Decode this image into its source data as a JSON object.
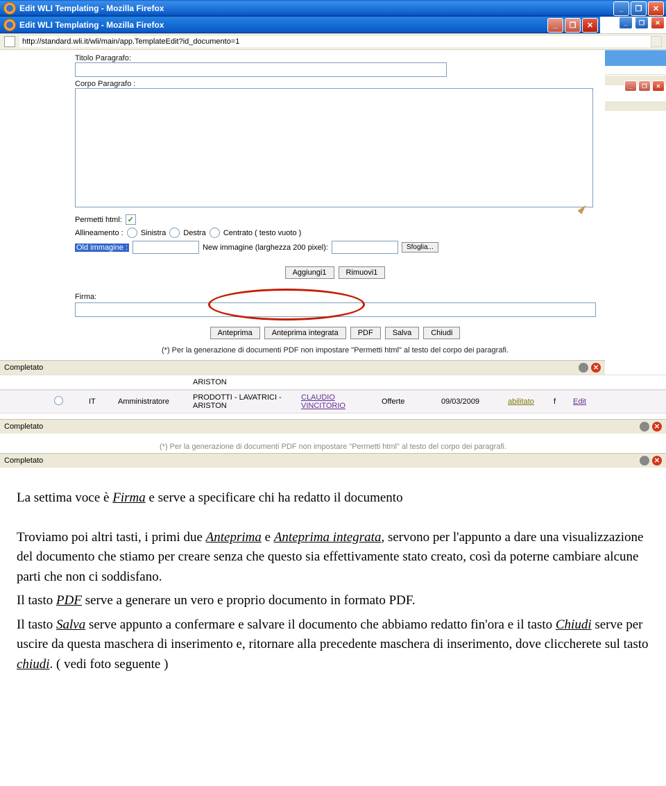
{
  "outer_window": {
    "title": "Edit WLI Templating - Mozilla Firefox"
  },
  "inner_window": {
    "title": "Edit WLI Templating - Mozilla Firefox",
    "url": "http://standard.wli.it/wli/main/app.TemplateEdit?id_documento=1"
  },
  "form": {
    "titolo_label": "Titolo Paragrafo:",
    "corpo_label": "Corpo Paragrafo :",
    "permetti_html_label": "Permetti html:",
    "allineamento_label": "Allineamento :",
    "align_sinistra": "Sinistra",
    "align_destra": "Destra",
    "align_centrato": "Centrato ( testo vuoto )",
    "old_img_label": "Old immagine :",
    "new_img_label": "New immagine (larghezza 200 pixel):",
    "sfoglia_btn": "Sfoglia...",
    "aggiungi_btn": "Aggiungi1",
    "rimuovi_btn": "Rimuovi1",
    "firma_label": "Firma:",
    "btn_anteprima": "Anteprima",
    "btn_anteprima_int": "Anteprima integrata",
    "btn_pdf": "PDF",
    "btn_salva": "Salva",
    "btn_chiudi": "Chiudi",
    "note": "(*) Per la generazione di documenti PDF non impostare \"Permetti html\" al testo del corpo dei paragrafi."
  },
  "status": {
    "completato": "Completato"
  },
  "grid": {
    "row1": {
      "col1": "",
      "lang": "",
      "role": "",
      "ariston": "ARISTON",
      "person": "",
      "offerte": "",
      "date": "",
      "state": "",
      "f": "",
      "edit": ""
    },
    "row2": {
      "lang": "IT",
      "role": "Amministratore",
      "prod": "PRODOTTI - LAVATRICI - ARISTON",
      "person": "CLAUDIO VINCITORIO",
      "offerte": "Offerte",
      "date": "09/03/2009",
      "state": "abilitato",
      "f": "f",
      "edit": "Edit"
    },
    "footer_note": "(*) Per la generazione di documenti PDF non impostare \"Permetti html\" al testo del corpo dei paragrafi."
  },
  "article": {
    "p1a": "La settima voce è ",
    "p1b": "Firma",
    "p1c": " e serve a specificare chi ha redatto il documento",
    "p2a": "Troviamo poi altri tasti, i primi due ",
    "p2b": "Anteprima",
    "p2c": " e ",
    "p2d": "Anteprima integrata",
    "p2e": ", servono per l'appunto a dare una visualizzazione del documento che stiamo per creare senza che questo sia effettivamente stato creato, così da poterne cambiare alcune parti che non ci soddisfano.",
    "p3a": "Il tasto ",
    "p3b": "PDF",
    "p3c": " serve a generare un vero e proprio documento in formato PDF.",
    "p4a": "Il tasto ",
    "p4b": "Salva",
    "p4c": " serve appunto a confermare e salvare il documento che abbiamo redatto fin'ora e il tasto ",
    "p4d": "Chiudi",
    "p4e": " serve per uscire da questa maschera di inserimento e, ritornare alla precedente maschera di inserimento, dove cliccherete sul tasto ",
    "p4f": "chiudi",
    "p4g": ". ( vedi foto seguente )"
  }
}
